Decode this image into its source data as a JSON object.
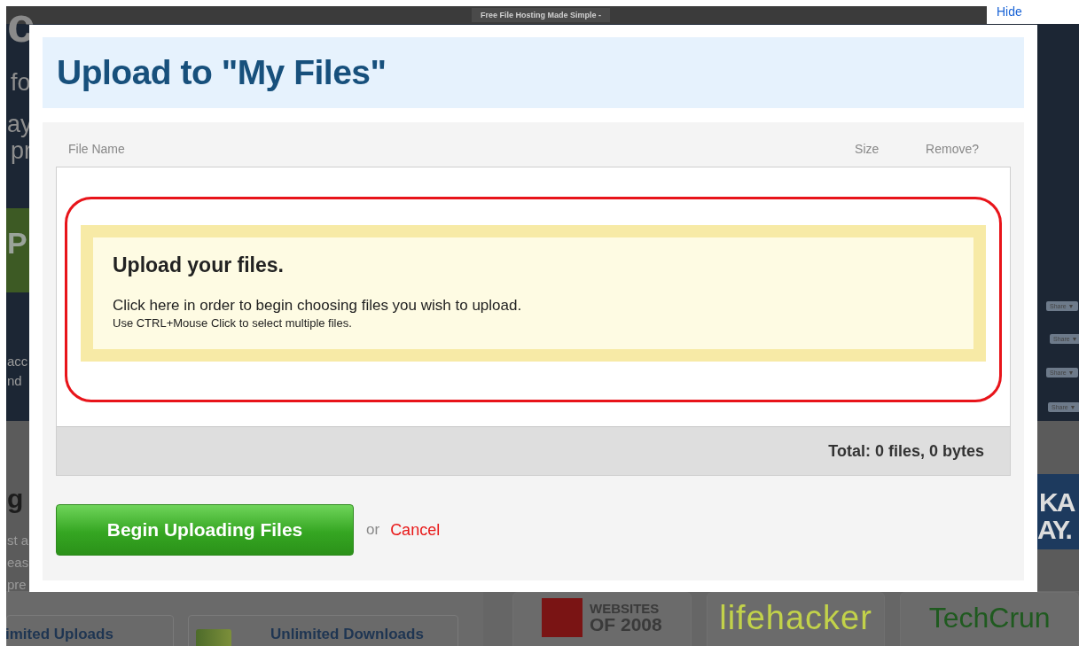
{
  "background": {
    "tab": "Free File Hosting Made Simple -",
    "fragments": [
      {
        "kind": "hero",
        "text": "c"
      },
      {
        "kind": "muted",
        "text": "fo"
      },
      {
        "kind": "muted",
        "text": "ay"
      },
      {
        "kind": "muted",
        "text": "pr"
      },
      {
        "kind": "banner",
        "text": "P"
      },
      {
        "kind": "small",
        "text": "acc"
      },
      {
        "kind": "small",
        "text": "nd"
      },
      {
        "kind": "heading",
        "text": "g"
      },
      {
        "kind": "small",
        "text": "st a"
      },
      {
        "kind": "small",
        "text": "eas"
      },
      {
        "kind": "small",
        "text": "pre"
      },
      {
        "kind": "share",
        "text": "Share ▼"
      },
      {
        "kind": "share",
        "text": "Share ▼"
      },
      {
        "kind": "share",
        "text": "Share ▼"
      },
      {
        "kind": "share",
        "text": "Share ▼"
      },
      {
        "kind": "ad",
        "text": "KA"
      },
      {
        "kind": "ad",
        "text": "AY."
      }
    ],
    "features": [
      "imited Uploads",
      "Unlimited Downloads"
    ],
    "press": [
      {
        "kind": "award",
        "lines": [
          "WEBSITES",
          "OF 2008"
        ]
      },
      {
        "kind": "lifehacker",
        "lines": [
          "lifehacker"
        ]
      },
      {
        "kind": "techcrunch",
        "lines": [
          "TechCrun"
        ]
      }
    ]
  },
  "hide_link": "Hide",
  "dialog": {
    "title": "Upload to \"My Files\"",
    "columns": [
      "File Name",
      "Size",
      "Remove?"
    ],
    "prompt": {
      "heading": "Upload your files.",
      "text": "Click here in order to begin choosing files you wish to upload.",
      "hint": "Use CTRL+Mouse Click to select multiple files."
    },
    "total": "Total: 0 files, 0 bytes",
    "begin_button": "Begin Uploading Files",
    "or": "or",
    "cancel": "Cancel"
  }
}
